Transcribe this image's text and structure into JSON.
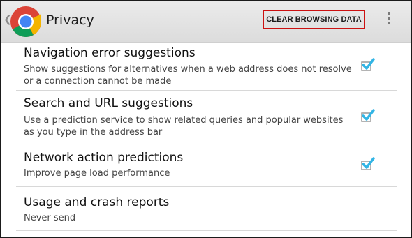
{
  "actionbar": {
    "title": "Privacy",
    "clear_label": "CLEAR BROWSING DATA",
    "logo_icon": "chrome-logo-icon",
    "overflow_icon": "overflow-menu-icon"
  },
  "settings": [
    {
      "title": "Navigation error suggestions",
      "summary": "Show suggestions for alternatives when a web address does not resolve or a connection cannot be made",
      "checked": true
    },
    {
      "title": "Search and URL suggestions",
      "summary": "Use a prediction service to show related queries and popular websites as you type in the address bar",
      "checked": true
    },
    {
      "title": "Network action predictions",
      "summary": "Improve page load performance",
      "checked": true
    },
    {
      "title": "Usage and crash reports",
      "summary": "Never send",
      "checked": false
    }
  ],
  "colors": {
    "checkmark": "#33b5e5",
    "highlight_border": "#cc1111"
  }
}
